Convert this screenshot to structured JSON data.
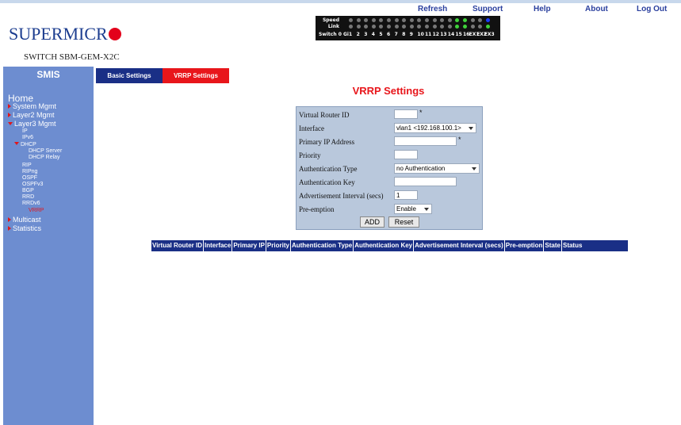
{
  "header": {
    "links": [
      "Refresh",
      "Support",
      "Help",
      "About",
      "Log Out"
    ],
    "logo_text": "SUPERMICR",
    "switch_name": "SWITCH SBM-GEM-X2C"
  },
  "port_panel": {
    "speed_label": "Speed",
    "link_label": "Link",
    "switch_label": "Switch 0 Gi",
    "ports": [
      "1",
      "2",
      "3",
      "4",
      "5",
      "6",
      "7",
      "8",
      "9",
      "10",
      "11",
      "12",
      "13",
      "14",
      "15",
      "16",
      "EX1",
      "EX2",
      "EX3"
    ],
    "speed_leds": [
      "gray",
      "gray",
      "gray",
      "gray",
      "gray",
      "gray",
      "gray",
      "gray",
      "gray",
      "gray",
      "gray",
      "gray",
      "gray",
      "gray",
      "green",
      "green",
      "gray",
      "gray",
      "blue"
    ],
    "link_leds": [
      "gray",
      "gray",
      "gray",
      "gray",
      "gray",
      "gray",
      "gray",
      "gray",
      "gray",
      "gray",
      "gray",
      "gray",
      "gray",
      "gray",
      "green",
      "green",
      "gray",
      "gray",
      "green"
    ]
  },
  "sidebar": {
    "title": "SMIS",
    "items": [
      {
        "label": "Home",
        "level": "home",
        "marker": "none"
      },
      {
        "label": "System Mgmt",
        "level": "l1",
        "marker": "right"
      },
      {
        "label": "Layer2 Mgmt",
        "level": "l1",
        "marker": "right"
      },
      {
        "label": "Layer3 Mgmt",
        "level": "l1",
        "marker": "down"
      },
      {
        "label": "IP",
        "level": "l2"
      },
      {
        "label": "IPv6",
        "level": "l2"
      },
      {
        "label": "DHCP",
        "level": "l2",
        "marker": "down"
      },
      {
        "label": "DHCP Server",
        "level": "l3"
      },
      {
        "label": "DHCP Relay",
        "level": "l3"
      },
      {
        "label": "RIP",
        "level": "l2"
      },
      {
        "label": "RIPng",
        "level": "l2"
      },
      {
        "label": "OSPF",
        "level": "l2"
      },
      {
        "label": "OSPFv3",
        "level": "l2"
      },
      {
        "label": "BGP",
        "level": "l2"
      },
      {
        "label": "RRD",
        "level": "l2"
      },
      {
        "label": "RRDv6",
        "level": "l2"
      },
      {
        "label": "VRRP",
        "level": "l3",
        "active": true
      },
      {
        "label": "Multicast",
        "level": "l1",
        "marker": "right"
      },
      {
        "label": "Statistics",
        "level": "l1",
        "marker": "right"
      }
    ]
  },
  "tabs": [
    {
      "label": "Basic Settings",
      "active": false
    },
    {
      "label": "VRRP Settings",
      "active": true
    }
  ],
  "page_title": "VRRP Settings",
  "form": {
    "fields": [
      {
        "label": "Virtual Router ID",
        "type": "input",
        "value": "",
        "required": true
      },
      {
        "label": "Interface",
        "type": "select",
        "value": "vlan1 <192.168.100.1>"
      },
      {
        "label": "Primary IP Address",
        "type": "input",
        "value": "",
        "required": true
      },
      {
        "label": "Priority",
        "type": "input",
        "value": ""
      },
      {
        "label": "Authentication Type",
        "type": "select",
        "value": "no Authentication"
      },
      {
        "label": "Authentication Key",
        "type": "input",
        "value": ""
      },
      {
        "label": "Advertisement Interval (secs)",
        "type": "input",
        "value": "1"
      },
      {
        "label": "Pre-emption",
        "type": "select",
        "value": "Enable"
      }
    ],
    "required_mark": "*",
    "add_label": "ADD",
    "reset_label": "Reset"
  },
  "table": {
    "columns": [
      "Virtual Router ID",
      "Interface",
      "Primary IP",
      "Priority",
      "Authentication Type",
      "Authentication Key",
      "Advertisement Interval (secs)",
      "Pre-emption",
      "State",
      "Status"
    ]
  },
  "colors": {
    "sidebar_bg": "#6d8dd0",
    "tab_active": "#e8161b",
    "tab_inactive": "#1a2f86",
    "table_header": "#1a2f86",
    "form_bg": "#b9c8dc"
  }
}
